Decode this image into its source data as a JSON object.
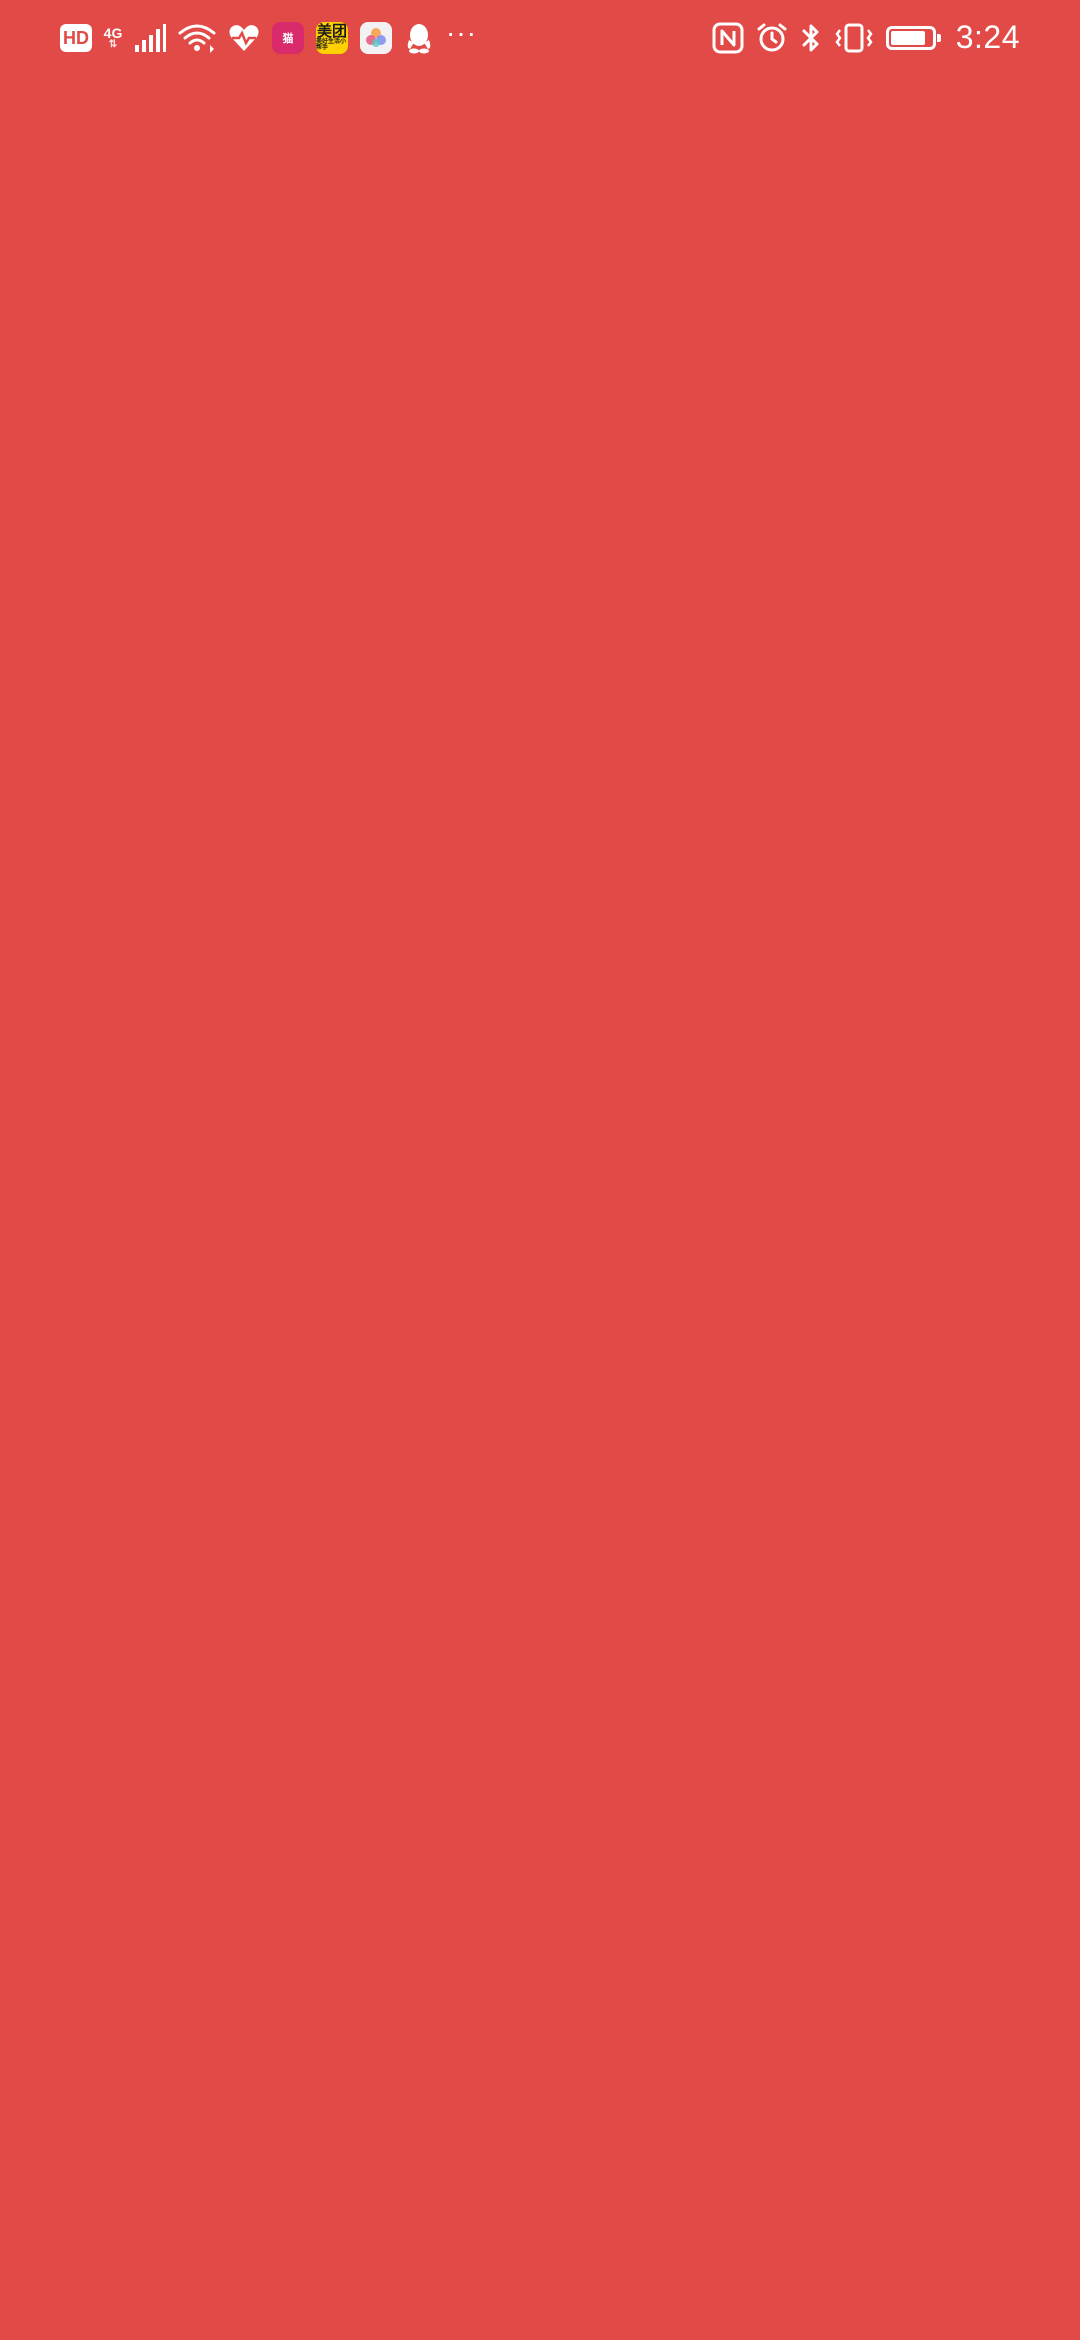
{
  "colors": {
    "background": "#e14a46",
    "status_foreground": "#ffffff"
  },
  "status_bar": {
    "left": {
      "hd_label": "HD",
      "network_type": "4G",
      "network_sub": "⇅",
      "signal_icon": "cell-signal-icon",
      "wifi_icon": "wifi-icon",
      "notifications": [
        {
          "name": "health-app-icon"
        },
        {
          "name": "tmall-app-icon",
          "label": "猫"
        },
        {
          "name": "meituan-app-icon",
          "label": "美团",
          "sublabel": "美好生活小帮手"
        },
        {
          "name": "gallery-app-icon"
        },
        {
          "name": "qq-app-icon"
        }
      ],
      "more": "···"
    },
    "right": {
      "nfc_icon": "nfc-icon",
      "alarm_icon": "alarm-icon",
      "bluetooth_icon": "bluetooth-icon",
      "vibrate_icon": "vibrate-icon",
      "battery_level": 0.85,
      "time": "3:24"
    }
  }
}
